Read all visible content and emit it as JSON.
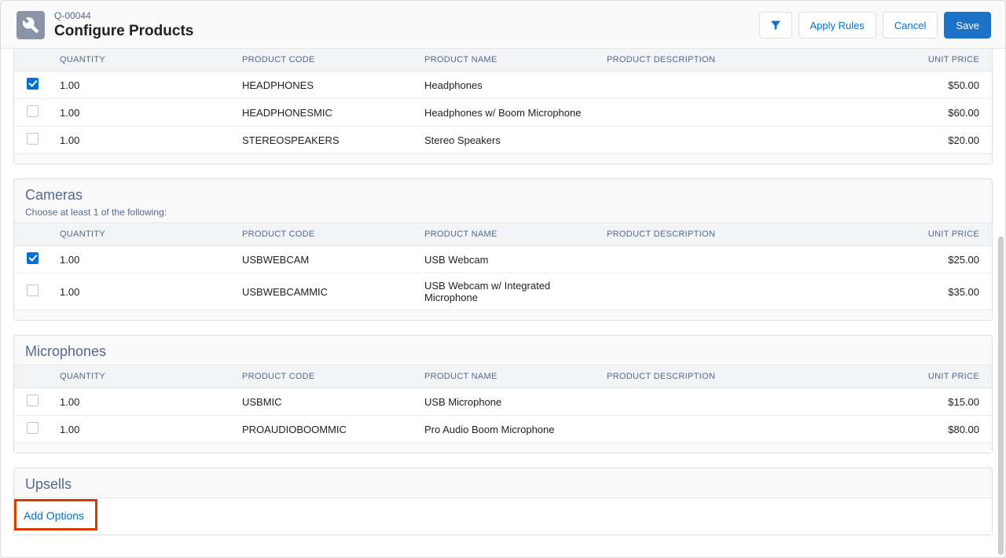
{
  "header": {
    "subtitle": "Q-00044",
    "title": "Configure Products",
    "apply_rules_label": "Apply Rules",
    "cancel_label": "Cancel",
    "save_label": "Save"
  },
  "columns": {
    "quantity": "QUANTITY",
    "product_code": "PRODUCT CODE",
    "product_name": "PRODUCT NAME",
    "product_description": "PRODUCT DESCRIPTION",
    "unit_price": "UNIT PRICE"
  },
  "groups": [
    {
      "title": "",
      "subtitle": "",
      "rows": [
        {
          "checked": true,
          "quantity": "1.00",
          "code": "HEADPHONES",
          "name": "Headphones",
          "desc": "",
          "price": "$50.00"
        },
        {
          "checked": false,
          "quantity": "1.00",
          "code": "HEADPHONESMIC",
          "name": "Headphones w/ Boom Microphone",
          "desc": "",
          "price": "$60.00"
        },
        {
          "checked": false,
          "quantity": "1.00",
          "code": "STEREOSPEAKERS",
          "name": "Stereo Speakers",
          "desc": "",
          "price": "$20.00"
        }
      ]
    },
    {
      "title": "Cameras",
      "subtitle": "Choose at least 1 of the following:",
      "rows": [
        {
          "checked": true,
          "quantity": "1.00",
          "code": "USBWEBCAM",
          "name": "USB Webcam",
          "desc": "",
          "price": "$25.00"
        },
        {
          "checked": false,
          "quantity": "1.00",
          "code": "USBWEBCAMMIC",
          "name": "USB Webcam w/ Integrated Microphone",
          "desc": "",
          "price": "$35.00"
        }
      ]
    },
    {
      "title": "Microphones",
      "subtitle": "",
      "rows": [
        {
          "checked": false,
          "quantity": "1.00",
          "code": "USBMIC",
          "name": "USB Microphone",
          "desc": "",
          "price": "$15.00"
        },
        {
          "checked": false,
          "quantity": "1.00",
          "code": "PROAUDIOBOOMMIC",
          "name": "Pro Audio Boom Microphone",
          "desc": "",
          "price": "$80.00"
        }
      ]
    },
    {
      "title": "Upsells",
      "subtitle": "",
      "rows": [],
      "add_options_label": "Add Options"
    }
  ]
}
